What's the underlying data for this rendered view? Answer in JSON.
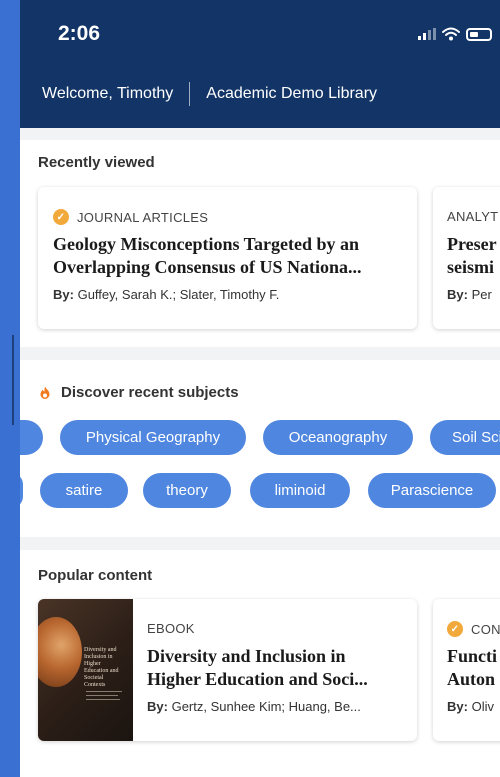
{
  "status_bar": {
    "time": "2:06"
  },
  "header": {
    "welcome": "Welcome, Timothy",
    "library": "Academic Demo Library"
  },
  "recently_viewed": {
    "title": "Recently viewed",
    "cards": [
      {
        "type": "JOURNAL ARTICLES",
        "title_line1": "Geology Misconceptions Targeted by an",
        "title_line2": "Overlapping Consensus of US Nationa...",
        "by_label": "By:",
        "authors": "Guffey, Sarah K.; Slater, Timothy F."
      },
      {
        "type": "ANALYT",
        "title_line1": "Preser",
        "title_line2": "seismi",
        "by_label": "By:",
        "authors": "Per"
      }
    ]
  },
  "subjects": {
    "title": "Discover recent subjects",
    "row1": [
      "Physical Geography",
      "Oceanography",
      "Soil Sci"
    ],
    "row2": [
      "satire",
      "theory",
      "liminoid",
      "Parascience"
    ]
  },
  "popular": {
    "title": "Popular content",
    "cards": [
      {
        "type": "EBOOK",
        "title_line1": "Diversity and Inclusion in",
        "title_line2": "Higher Education and Soci...",
        "by_label": "By:",
        "authors": "Gertz, Sunhee Kim; Huang, Be...",
        "cover_title": "Diversity and Inclusion in Higher Education and Societal Contexts"
      },
      {
        "type": "CON",
        "title_line1": "Functi",
        "title_line2": "Auton",
        "by_label": "By:",
        "authors": "Oliv"
      }
    ]
  },
  "colors": {
    "header_bg": "#123466",
    "pill_bg": "#4f86df",
    "badge": "#f2a93b"
  }
}
